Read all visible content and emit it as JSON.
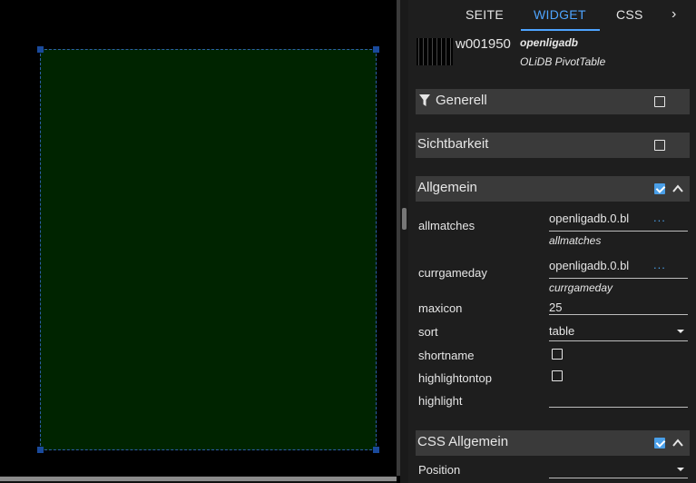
{
  "tabs": {
    "page": "SEITE",
    "widget": "WIDGET",
    "css": "CSS",
    "more": "›"
  },
  "widget": {
    "id": "w001950",
    "set": "openligadb",
    "type": "OLiDB PivotTable"
  },
  "groups": {
    "general": {
      "title": "Generell",
      "checked": false
    },
    "visibility": {
      "title": "Sichtbarkeit",
      "checked": false
    },
    "common": {
      "title": "Allgemein",
      "checked": true,
      "expanded": true
    },
    "css_common": {
      "title": "CSS Allgemein",
      "checked": true,
      "expanded": true
    }
  },
  "properties": {
    "allmatches": {
      "label": "allmatches",
      "value": "openligadb.0.bl",
      "sub": "allmatches",
      "more": "..."
    },
    "currgameday": {
      "label": "currgameday",
      "value": "openligadb.0.bl",
      "sub": "currgameday",
      "more": "..."
    },
    "maxicon": {
      "label": "maxicon",
      "value": "25"
    },
    "sort": {
      "label": "sort",
      "value": "table"
    },
    "shortname": {
      "label": "shortname",
      "checked": false
    },
    "highlightontop": {
      "label": "highlightontop",
      "checked": false
    },
    "highlight": {
      "label": "highlight",
      "value": ""
    },
    "position": {
      "label": "Position",
      "value": ""
    }
  },
  "colors": {
    "accent": "#4ea4ff",
    "widget_bg": "#002400",
    "panel_bg": "#1e1e1e",
    "group_bg": "#3a3a3a"
  }
}
